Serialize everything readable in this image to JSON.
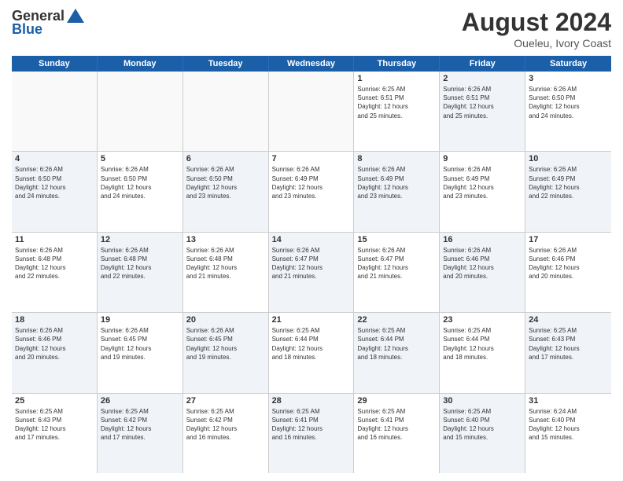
{
  "header": {
    "logo_general": "General",
    "logo_blue": "Blue",
    "title": "August 2024",
    "location": "Oueleu, Ivory Coast"
  },
  "days_of_week": [
    "Sunday",
    "Monday",
    "Tuesday",
    "Wednesday",
    "Thursday",
    "Friday",
    "Saturday"
  ],
  "weeks": [
    [
      {
        "day": "",
        "info": "",
        "empty": true
      },
      {
        "day": "",
        "info": "",
        "empty": true
      },
      {
        "day": "",
        "info": "",
        "empty": true
      },
      {
        "day": "",
        "info": "",
        "empty": true
      },
      {
        "day": "1",
        "info": "Sunrise: 6:25 AM\nSunset: 6:51 PM\nDaylight: 12 hours\nand 25 minutes.",
        "shaded": false
      },
      {
        "day": "2",
        "info": "Sunrise: 6:26 AM\nSunset: 6:51 PM\nDaylight: 12 hours\nand 25 minutes.",
        "shaded": true
      },
      {
        "day": "3",
        "info": "Sunrise: 6:26 AM\nSunset: 6:50 PM\nDaylight: 12 hours\nand 24 minutes.",
        "shaded": false
      }
    ],
    [
      {
        "day": "4",
        "info": "Sunrise: 6:26 AM\nSunset: 6:50 PM\nDaylight: 12 hours\nand 24 minutes.",
        "shaded": true
      },
      {
        "day": "5",
        "info": "Sunrise: 6:26 AM\nSunset: 6:50 PM\nDaylight: 12 hours\nand 24 minutes.",
        "shaded": false
      },
      {
        "day": "6",
        "info": "Sunrise: 6:26 AM\nSunset: 6:50 PM\nDaylight: 12 hours\nand 23 minutes.",
        "shaded": true
      },
      {
        "day": "7",
        "info": "Sunrise: 6:26 AM\nSunset: 6:49 PM\nDaylight: 12 hours\nand 23 minutes.",
        "shaded": false
      },
      {
        "day": "8",
        "info": "Sunrise: 6:26 AM\nSunset: 6:49 PM\nDaylight: 12 hours\nand 23 minutes.",
        "shaded": true
      },
      {
        "day": "9",
        "info": "Sunrise: 6:26 AM\nSunset: 6:49 PM\nDaylight: 12 hours\nand 23 minutes.",
        "shaded": false
      },
      {
        "day": "10",
        "info": "Sunrise: 6:26 AM\nSunset: 6:49 PM\nDaylight: 12 hours\nand 22 minutes.",
        "shaded": true
      }
    ],
    [
      {
        "day": "11",
        "info": "Sunrise: 6:26 AM\nSunset: 6:48 PM\nDaylight: 12 hours\nand 22 minutes.",
        "shaded": false
      },
      {
        "day": "12",
        "info": "Sunrise: 6:26 AM\nSunset: 6:48 PM\nDaylight: 12 hours\nand 22 minutes.",
        "shaded": true
      },
      {
        "day": "13",
        "info": "Sunrise: 6:26 AM\nSunset: 6:48 PM\nDaylight: 12 hours\nand 21 minutes.",
        "shaded": false
      },
      {
        "day": "14",
        "info": "Sunrise: 6:26 AM\nSunset: 6:47 PM\nDaylight: 12 hours\nand 21 minutes.",
        "shaded": true
      },
      {
        "day": "15",
        "info": "Sunrise: 6:26 AM\nSunset: 6:47 PM\nDaylight: 12 hours\nand 21 minutes.",
        "shaded": false
      },
      {
        "day": "16",
        "info": "Sunrise: 6:26 AM\nSunset: 6:46 PM\nDaylight: 12 hours\nand 20 minutes.",
        "shaded": true
      },
      {
        "day": "17",
        "info": "Sunrise: 6:26 AM\nSunset: 6:46 PM\nDaylight: 12 hours\nand 20 minutes.",
        "shaded": false
      }
    ],
    [
      {
        "day": "18",
        "info": "Sunrise: 6:26 AM\nSunset: 6:46 PM\nDaylight: 12 hours\nand 20 minutes.",
        "shaded": true
      },
      {
        "day": "19",
        "info": "Sunrise: 6:26 AM\nSunset: 6:45 PM\nDaylight: 12 hours\nand 19 minutes.",
        "shaded": false
      },
      {
        "day": "20",
        "info": "Sunrise: 6:26 AM\nSunset: 6:45 PM\nDaylight: 12 hours\nand 19 minutes.",
        "shaded": true
      },
      {
        "day": "21",
        "info": "Sunrise: 6:25 AM\nSunset: 6:44 PM\nDaylight: 12 hours\nand 18 minutes.",
        "shaded": false
      },
      {
        "day": "22",
        "info": "Sunrise: 6:25 AM\nSunset: 6:44 PM\nDaylight: 12 hours\nand 18 minutes.",
        "shaded": true
      },
      {
        "day": "23",
        "info": "Sunrise: 6:25 AM\nSunset: 6:44 PM\nDaylight: 12 hours\nand 18 minutes.",
        "shaded": false
      },
      {
        "day": "24",
        "info": "Sunrise: 6:25 AM\nSunset: 6:43 PM\nDaylight: 12 hours\nand 17 minutes.",
        "shaded": true
      }
    ],
    [
      {
        "day": "25",
        "info": "Sunrise: 6:25 AM\nSunset: 6:43 PM\nDaylight: 12 hours\nand 17 minutes.",
        "shaded": false
      },
      {
        "day": "26",
        "info": "Sunrise: 6:25 AM\nSunset: 6:42 PM\nDaylight: 12 hours\nand 17 minutes.",
        "shaded": true
      },
      {
        "day": "27",
        "info": "Sunrise: 6:25 AM\nSunset: 6:42 PM\nDaylight: 12 hours\nand 16 minutes.",
        "shaded": false
      },
      {
        "day": "28",
        "info": "Sunrise: 6:25 AM\nSunset: 6:41 PM\nDaylight: 12 hours\nand 16 minutes.",
        "shaded": true
      },
      {
        "day": "29",
        "info": "Sunrise: 6:25 AM\nSunset: 6:41 PM\nDaylight: 12 hours\nand 16 minutes.",
        "shaded": false
      },
      {
        "day": "30",
        "info": "Sunrise: 6:25 AM\nSunset: 6:40 PM\nDaylight: 12 hours\nand 15 minutes.",
        "shaded": true
      },
      {
        "day": "31",
        "info": "Sunrise: 6:24 AM\nSunset: 6:40 PM\nDaylight: 12 hours\nand 15 minutes.",
        "shaded": false
      }
    ]
  ]
}
